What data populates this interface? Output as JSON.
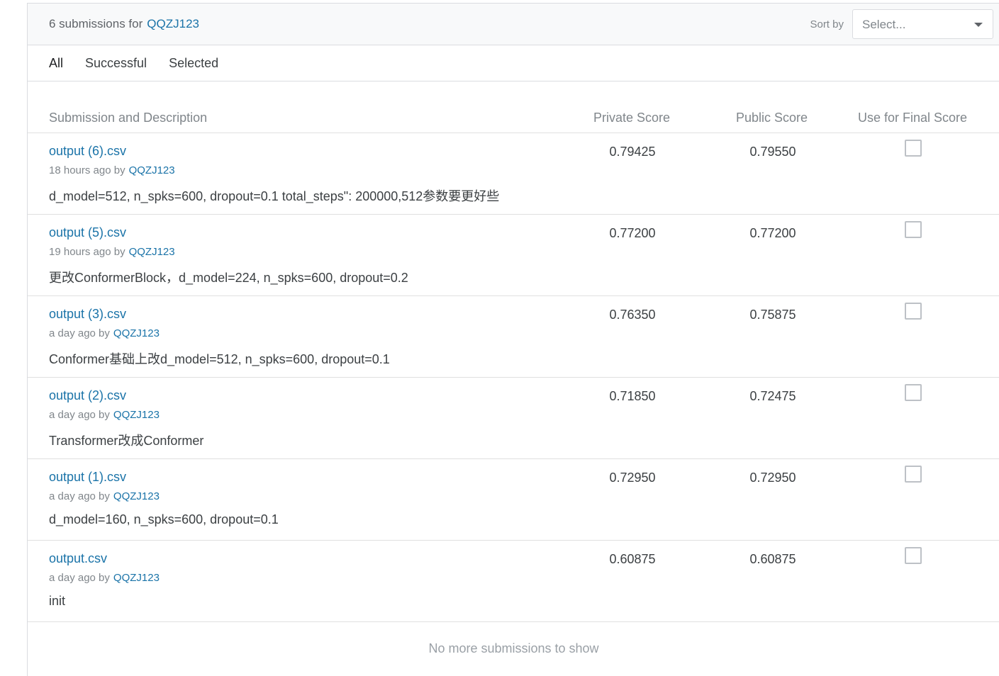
{
  "header": {
    "count_text": "6 submissions for",
    "user": "QQZJ123",
    "sort_label": "Sort by",
    "sort_placeholder": "Select..."
  },
  "tabs": [
    {
      "label": "All",
      "active": true
    },
    {
      "label": "Successful",
      "active": false
    },
    {
      "label": "Selected",
      "active": false
    }
  ],
  "columns": {
    "submission": "Submission and Description",
    "private": "Private Score",
    "public": "Public Score",
    "final": "Use for Final Score"
  },
  "submissions": [
    {
      "file": "output (6).csv",
      "time": "18 hours ago by",
      "user": "QQZJ123",
      "description": "d_model=512, n_spks=600, dropout=0.1 total_steps\": 200000,512参数要更好些",
      "private": "0.79425",
      "public": "0.79550",
      "selected": false
    },
    {
      "file": "output (5).csv",
      "time": "19 hours ago by",
      "user": "QQZJ123",
      "description": "更改ConformerBlock，d_model=224, n_spks=600, dropout=0.2",
      "private": "0.77200",
      "public": "0.77200",
      "selected": false
    },
    {
      "file": "output (3).csv",
      "time": "a day ago by",
      "user": "QQZJ123",
      "description": "Conformer基础上改d_model=512, n_spks=600, dropout=0.1",
      "private": "0.76350",
      "public": "0.75875",
      "selected": false
    },
    {
      "file": "output (2).csv",
      "time": "a day ago by",
      "user": "QQZJ123",
      "description": "Transformer改成Conformer",
      "private": "0.71850",
      "public": "0.72475",
      "selected": false
    },
    {
      "file": "output (1).csv",
      "time": "a day ago by",
      "user": "QQZJ123",
      "description": "d_model=160, n_spks=600, dropout=0.1",
      "private": "0.72950",
      "public": "0.72950",
      "selected": false
    },
    {
      "file": "output.csv",
      "time": "a day ago by",
      "user": "QQZJ123",
      "description": "init",
      "private": "0.60875",
      "public": "0.60875",
      "selected": false
    }
  ],
  "footer": "No more submissions to show"
}
